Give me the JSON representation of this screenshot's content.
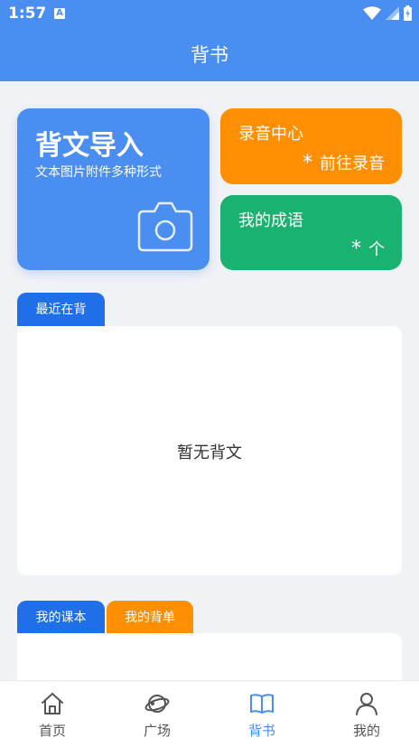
{
  "status_bar": {
    "time": "1:57",
    "notification_icon": "A"
  },
  "header": {
    "title": "背书"
  },
  "import_card": {
    "title": "背文导入",
    "subtitle": "文本图片附件多种形式",
    "icon": "camera-icon",
    "color": "#4a8ef1"
  },
  "record_card": {
    "title": "录音中心",
    "star": "*",
    "action": "前往录音",
    "color": "#ff8f00"
  },
  "idiom_card": {
    "title": "我的成语",
    "star": "*",
    "action": "个",
    "color": "#1ab271"
  },
  "recent": {
    "tab_label": "最近在背",
    "empty_text": "暂无背文"
  },
  "courses": {
    "tabs": [
      {
        "label": "我的课本",
        "color": "#1f6fe8"
      },
      {
        "label": "我的背单",
        "color": "#ff8f00"
      }
    ]
  },
  "tab_bar": {
    "items": [
      {
        "label": "首页",
        "icon": "home-icon",
        "active": false
      },
      {
        "label": "广场",
        "icon": "planet-icon",
        "active": false
      },
      {
        "label": "背书",
        "icon": "book-icon",
        "active": true
      },
      {
        "label": "我的",
        "icon": "person-icon",
        "active": false
      }
    ],
    "active_color": "#4a8ef1"
  }
}
